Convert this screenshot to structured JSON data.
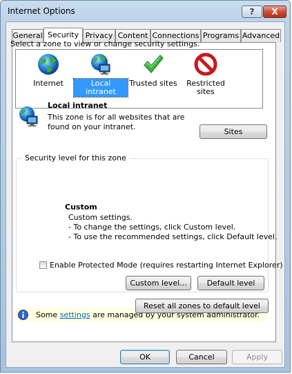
{
  "window": {
    "title": "Internet Options",
    "help_label": "?",
    "close_label": "X"
  },
  "tabs": [
    {
      "label": "General"
    },
    {
      "label": "Security",
      "active": true
    },
    {
      "label": "Privacy"
    },
    {
      "label": "Content"
    },
    {
      "label": "Connections"
    },
    {
      "label": "Programs"
    },
    {
      "label": "Advanced"
    }
  ],
  "zones": {
    "prompt": "Select a zone to view or change security settings.",
    "items": [
      {
        "label": "Internet",
        "icon": "globe-icon"
      },
      {
        "label": "Local intranet",
        "icon": "intranet-globe-icon",
        "selected": true
      },
      {
        "label": "Trusted sites",
        "icon": "checkmark-icon"
      },
      {
        "label": "Restricted sites",
        "icon": "no-entry-icon"
      }
    ]
  },
  "zone_detail": {
    "title": "Local intranet",
    "description": "This zone is for all websites that are found on your intranet.",
    "sites_button": "Sites"
  },
  "security_level": {
    "legend": "Security level for this zone",
    "level_name": "Custom",
    "lines": [
      "Custom settings.",
      "- To change the settings, click Custom level.",
      "- To use the recommended settings, click Default level."
    ],
    "protected_mode_label": "Enable Protected Mode (requires restarting Internet Explorer)",
    "protected_mode_checked": false,
    "custom_level_button": "Custom level...",
    "default_level_button": "Default level"
  },
  "reset_button": "Reset all zones to default level",
  "info": {
    "prefix": "Some ",
    "link": "settings",
    "suffix": " are managed by your system administrator."
  },
  "footer": {
    "ok": "OK",
    "cancel": "Cancel",
    "apply": "Apply"
  },
  "colors": {
    "selection": "#3399ff",
    "link": "#0066cc",
    "info_background": "#ffffe1"
  }
}
